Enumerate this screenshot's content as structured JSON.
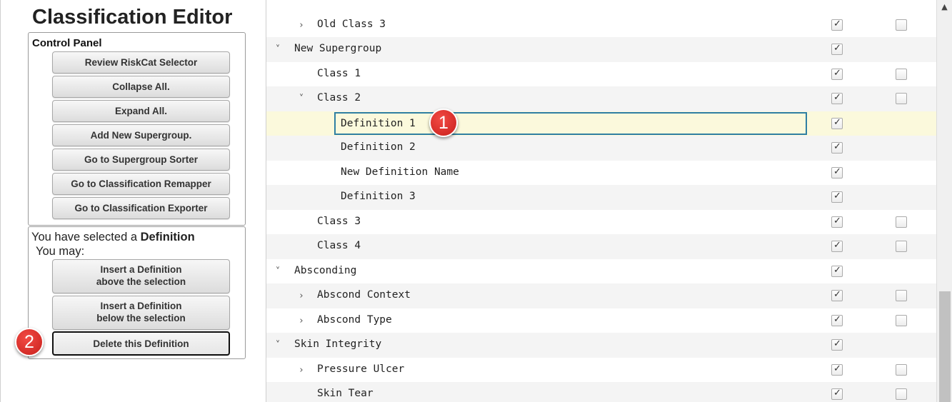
{
  "editor": {
    "title": "Classification Editor"
  },
  "control_panel": {
    "heading": "Control Panel",
    "buttons": [
      "Review RiskCat Selector",
      "Collapse All.",
      "Expand All.",
      "Add New Supergroup.",
      "Go to Supergroup Sorter",
      "Go to Classification Remapper",
      "Go to Classification Exporter"
    ]
  },
  "selection_panel": {
    "prefix": "You have selected a ",
    "type": "Definition",
    "may": "You may:",
    "insert_above": {
      "line1": "Insert a Definition",
      "line2": "above the selection"
    },
    "insert_below": {
      "line1": "Insert a Definition",
      "line2": "below the selection"
    },
    "delete": "Delete this Definition"
  },
  "callouts": {
    "one": "1",
    "two": "2"
  },
  "icons": {
    "expand": "›",
    "collapse": "˅",
    "check": "✓",
    "scroll_up": "▲"
  },
  "colors": {
    "selected_row": "#fbf9dc",
    "edit_border": "#2f7fa3",
    "callout": "#d92b26"
  },
  "tree": {
    "rows": [
      {
        "label": "Old Class 3",
        "level": 1,
        "toggle": "expand",
        "active": true,
        "other": false
      },
      {
        "label": "New Supergroup",
        "level": 0,
        "toggle": "collapse",
        "active": true,
        "other": null
      },
      {
        "label": "Class 1",
        "level": 1,
        "toggle": null,
        "active": true,
        "other": false
      },
      {
        "label": "Class 2",
        "level": 1,
        "toggle": "collapse",
        "active": true,
        "other": false
      },
      {
        "label": "Definition 1",
        "level": 2,
        "toggle": null,
        "active": true,
        "other": null,
        "selected": true
      },
      {
        "label": "Definition 2",
        "level": 2,
        "toggle": null,
        "active": true,
        "other": null
      },
      {
        "label": "New Definition Name",
        "level": 2,
        "toggle": null,
        "active": true,
        "other": null
      },
      {
        "label": "Definition 3",
        "level": 2,
        "toggle": null,
        "active": true,
        "other": null
      },
      {
        "label": "Class 3",
        "level": 1,
        "toggle": null,
        "active": true,
        "other": false
      },
      {
        "label": "Class 4",
        "level": 1,
        "toggle": null,
        "active": true,
        "other": false
      },
      {
        "label": "Absconding",
        "level": 0,
        "toggle": "collapse",
        "active": true,
        "other": null
      },
      {
        "label": "Abscond Context",
        "level": 1,
        "toggle": "expand",
        "active": true,
        "other": false
      },
      {
        "label": "Abscond Type",
        "level": 1,
        "toggle": "expand",
        "active": true,
        "other": false
      },
      {
        "label": "Skin Integrity",
        "level": 0,
        "toggle": "collapse",
        "active": true,
        "other": null
      },
      {
        "label": "Pressure Ulcer",
        "level": 1,
        "toggle": "expand",
        "active": true,
        "other": false
      },
      {
        "label": "Skin Tear",
        "level": 1,
        "toggle": null,
        "active": true,
        "other": false
      }
    ]
  },
  "scrollbar": {
    "position": 0.85
  }
}
